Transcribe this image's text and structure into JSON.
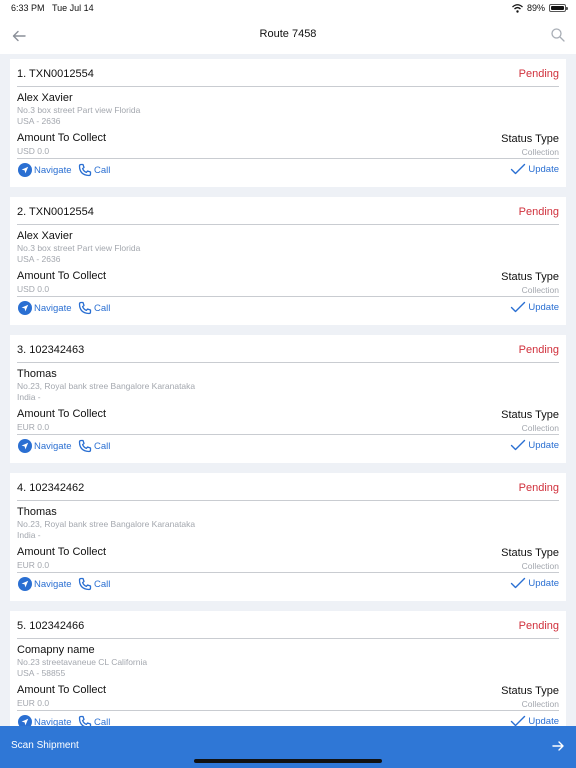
{
  "status_bar": {
    "time": "6:33 PM",
    "date": "Tue Jul 14",
    "battery": "89%",
    "battery_level": 0.89
  },
  "navbar": {
    "back_icon": "back-arrow-icon",
    "title": "Route 7458",
    "search_icon": "search-icon"
  },
  "labels": {
    "amount": "Amount To Collect",
    "status_type": "Status Type",
    "navigate": "Navigate",
    "call": "Call",
    "update": "Update"
  },
  "colors": {
    "accent": "#2f77d6",
    "pending": "#d0303c"
  },
  "cards": [
    {
      "txn": "1. TXN0012554",
      "status": "Pending",
      "name": "Alex Xavier",
      "address1": "No.3 box street Part view Florida",
      "address2": "USA - 2636",
      "amount": "USD 0.0",
      "status_type": "Collection"
    },
    {
      "txn": "2. TXN0012554",
      "status": "Pending",
      "name": "Alex Xavier",
      "address1": "No.3 box street Part view Florida",
      "address2": "USA - 2636",
      "amount": "USD 0.0",
      "status_type": "Collection"
    },
    {
      "txn": "3. 102342463",
      "status": "Pending",
      "name": "Thomas",
      "address1": "No.23, Royal bank stree Bangalore Karanataka",
      "address2": "India -",
      "amount": "EUR 0.0",
      "status_type": "Collection"
    },
    {
      "txn": "4. 102342462",
      "status": "Pending",
      "name": "Thomas",
      "address1": "No.23, Royal bank stree Bangalore Karanataka",
      "address2": "India -",
      "amount": "EUR 0.0",
      "status_type": "Collection"
    },
    {
      "txn": "5. 102342466",
      "status": "Pending",
      "name": "Comapny name",
      "address1": "No.23 streetavaneue CL California",
      "address2": "USA - 58855",
      "amount": "EUR 0.0",
      "status_type": "Collection"
    }
  ],
  "scan_bar": {
    "label": "Scan Shipment",
    "icon": "arrow-right-icon"
  }
}
